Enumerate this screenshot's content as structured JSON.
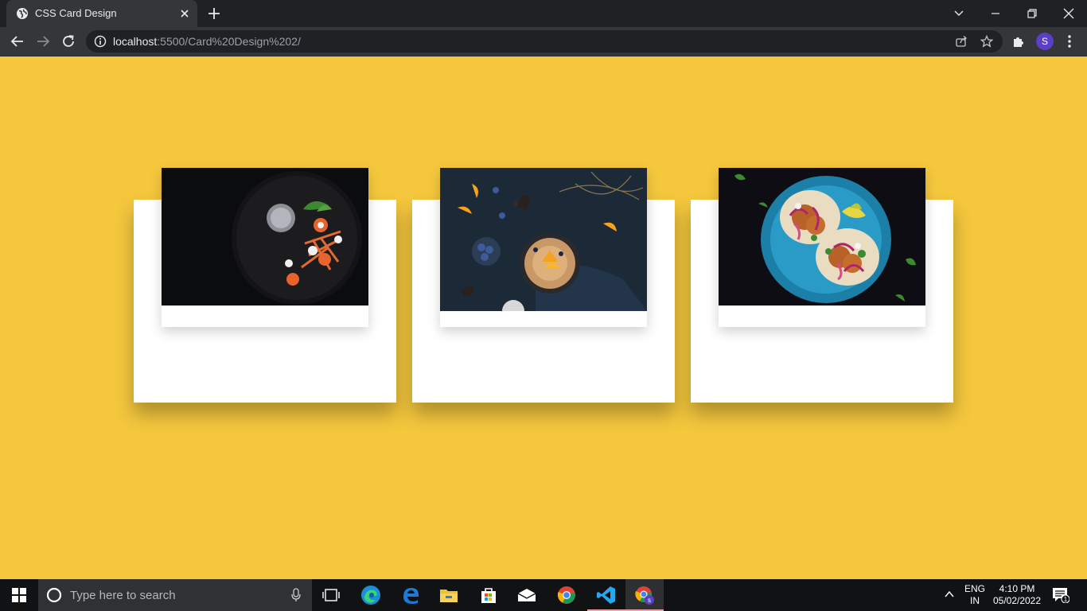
{
  "browser": {
    "tab_title": "CSS Card Design",
    "url_host": "localhost",
    "url_rest": ":5500/Card%20Design%202/",
    "profile_initial": "S"
  },
  "page": {
    "background_color": "#f4c73d",
    "cards": [
      {
        "image": "dessert-plate-image"
      },
      {
        "image": "pancake-skillet-image"
      },
      {
        "image": "tacos-plate-image"
      }
    ]
  },
  "taskbar": {
    "search_placeholder": "Type here to search",
    "lang_line1": "ENG",
    "lang_line2": "IN",
    "time": "4:10 PM",
    "date": "05/02/2022",
    "notification_count": "1"
  }
}
